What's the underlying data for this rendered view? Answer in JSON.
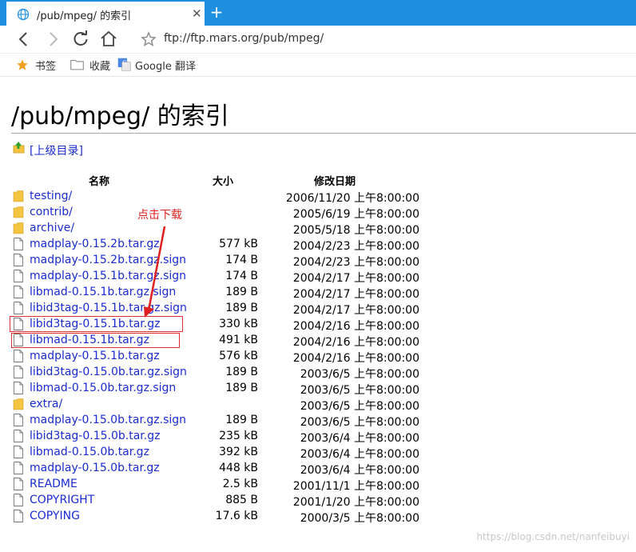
{
  "tab": {
    "title": "/pub/mpeg/ 的索引",
    "close_glyph": "✕",
    "new_glyph": "+"
  },
  "address": {
    "url": "ftp://ftp.mars.org/pub/mpeg/"
  },
  "bookmarks": [
    {
      "label": "书签",
      "icon": "star-icon"
    },
    {
      "label": "收藏",
      "icon": "folder-icon"
    },
    {
      "label": "Google 翻译",
      "icon": "translate-icon"
    }
  ],
  "page": {
    "title": "/pub/mpeg/ 的索引",
    "parent_label": "[上级目录]",
    "headers": {
      "name": "名称",
      "size": "大小",
      "modified": "修改日期"
    }
  },
  "files": [
    {
      "name": "testing/",
      "size": "",
      "date": "2006/11/20 上午8:00:00",
      "type": "folder"
    },
    {
      "name": "contrib/",
      "size": "",
      "date": "2005/6/19 上午8:00:00",
      "type": "folder"
    },
    {
      "name": "archive/",
      "size": "",
      "date": "2005/5/18 上午8:00:00",
      "type": "folder"
    },
    {
      "name": "madplay-0.15.2b.tar.gz",
      "size": "577 kB",
      "date": "2004/2/23 上午8:00:00",
      "type": "file"
    },
    {
      "name": "madplay-0.15.2b.tar.gz.sign",
      "size": "174 B",
      "date": "2004/2/23 上午8:00:00",
      "type": "file"
    },
    {
      "name": "madplay-0.15.1b.tar.gz.sign",
      "size": "174 B",
      "date": "2004/2/17 上午8:00:00",
      "type": "file"
    },
    {
      "name": "libmad-0.15.1b.tar.gz.sign",
      "size": "189 B",
      "date": "2004/2/17 上午8:00:00",
      "type": "file"
    },
    {
      "name": "libid3tag-0.15.1b.tar.gz.sign",
      "size": "189 B",
      "date": "2004/2/17 上午8:00:00",
      "type": "file"
    },
    {
      "name": "libid3tag-0.15.1b.tar.gz",
      "size": "330 kB",
      "date": "2004/2/16 上午8:00:00",
      "type": "file"
    },
    {
      "name": "libmad-0.15.1b.tar.gz",
      "size": "491 kB",
      "date": "2004/2/16 上午8:00:00",
      "type": "file"
    },
    {
      "name": "madplay-0.15.1b.tar.gz",
      "size": "576 kB",
      "date": "2004/2/16 上午8:00:00",
      "type": "file"
    },
    {
      "name": "libid3tag-0.15.0b.tar.gz.sign",
      "size": "189 B",
      "date": "2003/6/5 上午8:00:00",
      "type": "file"
    },
    {
      "name": "libmad-0.15.0b.tar.gz.sign",
      "size": "189 B",
      "date": "2003/6/5 上午8:00:00",
      "type": "file"
    },
    {
      "name": "extra/",
      "size": "",
      "date": "2003/6/5 上午8:00:00",
      "type": "folder"
    },
    {
      "name": "madplay-0.15.0b.tar.gz.sign",
      "size": "189 B",
      "date": "2003/6/5 上午8:00:00",
      "type": "file"
    },
    {
      "name": "libid3tag-0.15.0b.tar.gz",
      "size": "235 kB",
      "date": "2003/6/4 上午8:00:00",
      "type": "file"
    },
    {
      "name": "libmad-0.15.0b.tar.gz",
      "size": "392 kB",
      "date": "2003/6/4 上午8:00:00",
      "type": "file"
    },
    {
      "name": "madplay-0.15.0b.tar.gz",
      "size": "448 kB",
      "date": "2003/6/4 上午8:00:00",
      "type": "file"
    },
    {
      "name": "README",
      "size": "2.5 kB",
      "date": "2001/11/1 上午8:00:00",
      "type": "file"
    },
    {
      "name": "COPYRIGHT",
      "size": "885 B",
      "date": "2001/1/20 上午8:00:00",
      "type": "file"
    },
    {
      "name": "COPYING",
      "size": "17.6 kB",
      "date": "2000/3/5 上午8:00:00",
      "type": "file"
    }
  ],
  "annotation": {
    "text": "点击下载",
    "color": "#e02020"
  },
  "watermark": "https://blog.csdn.net/nanfeibuyi",
  "colors": {
    "tabbar": "#1f8fe0",
    "link": "#1a2bd0",
    "folder": "#f5c542",
    "highlight": "#e03030"
  }
}
